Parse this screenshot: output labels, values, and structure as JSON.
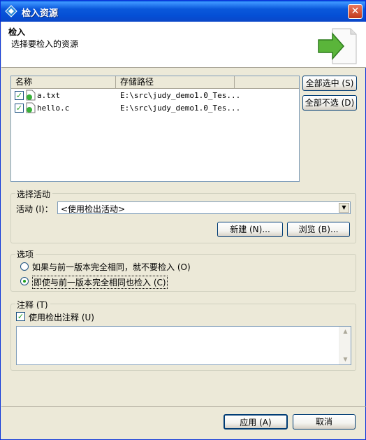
{
  "window": {
    "title": "检入资源",
    "close": "✕"
  },
  "header": {
    "title": "检入",
    "description": "选择要检入的资源"
  },
  "table": {
    "columns": [
      "名称",
      "存储路径"
    ],
    "rows": [
      {
        "checked": true,
        "name": "a.txt",
        "path": "E:\\src\\judy_demo1.0_Tes..."
      },
      {
        "checked": true,
        "name": "hello.c",
        "path": "E:\\src\\judy_demo1.0_Tes..."
      }
    ]
  },
  "buttons": {
    "select_all": "全部选中 (S)",
    "deselect_all": "全部不选 (D)",
    "new": "新建 (N)...",
    "browse": "浏览 (B)...",
    "apply": "应用 (A)",
    "cancel": "取消"
  },
  "activity": {
    "group_label": "选择活动",
    "field_label": "活动 (I)：",
    "selected": "<使用检出活动>"
  },
  "options": {
    "group_label": "选项",
    "radio1": "如果与前一版本完全相同，就不要检入 (O)",
    "radio2": "即使与前一版本完全相同也检入 (C)",
    "selected": 2
  },
  "comment": {
    "group_label": "注释 (T)",
    "checkbox_label": "使用检出注释 (U)",
    "checked": true,
    "value": ""
  },
  "colors": {
    "accent": "#0a58db",
    "check": "#21a121",
    "border": "#7f9db9"
  }
}
